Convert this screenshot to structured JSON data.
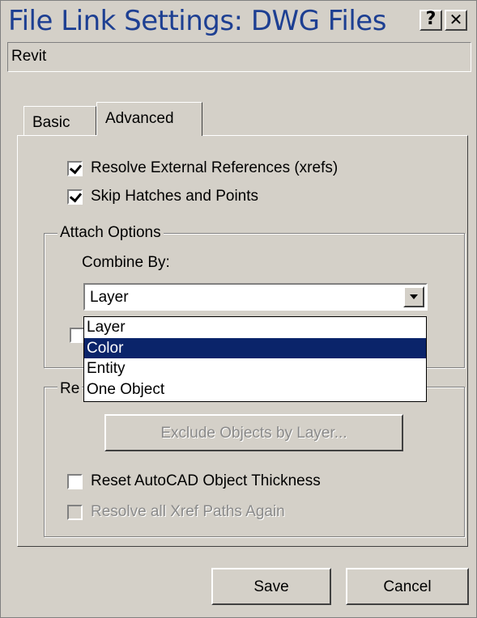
{
  "window": {
    "title": "File Link Settings: DWG Files",
    "help_label": "?",
    "close_label": "✕"
  },
  "preset": {
    "value": "Revit"
  },
  "tabs": [
    {
      "label": "Basic",
      "active": false
    },
    {
      "label": "Advanced",
      "active": true
    }
  ],
  "options": {
    "resolve_xrefs": {
      "label": "Resolve External References (xrefs)",
      "checked": true
    },
    "skip_hatches": {
      "label": "Skip Hatches and Points",
      "checked": true
    }
  },
  "attach_options": {
    "legend": "Attach Options",
    "combine_by_label": "Combine By:",
    "combine_by_value": "Layer",
    "dropdown_items": [
      {
        "label": "Layer",
        "selected": false
      },
      {
        "label": "Color",
        "selected": true
      },
      {
        "label": "Entity",
        "selected": false
      },
      {
        "label": "One Object",
        "selected": false
      }
    ]
  },
  "reload_group": {
    "legend_visible": "Re",
    "exclude_button": "Exclude Objects by Layer...",
    "reset_thickness": {
      "label": "Reset AutoCAD Object Thickness",
      "checked": false
    },
    "resolve_xref_paths": {
      "label": "Resolve all Xref Paths Again",
      "checked": false,
      "disabled": true
    }
  },
  "footer": {
    "save_label": "Save",
    "cancel_label": "Cancel"
  },
  "colors": {
    "title_text": "#1d3f92",
    "selection_bg": "#0a246a",
    "dialog_bg": "#d4d0c8"
  }
}
